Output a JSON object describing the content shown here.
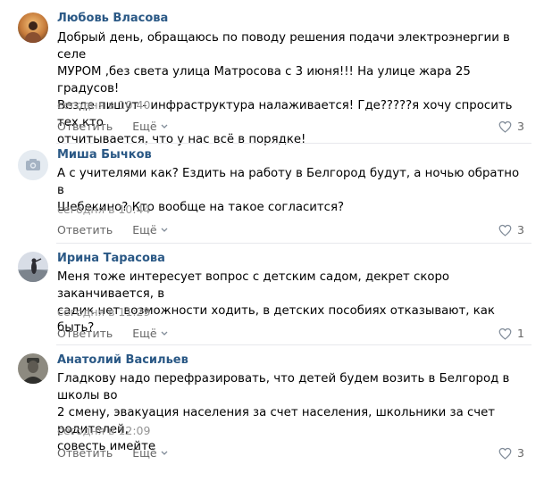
{
  "comments": [
    {
      "author": "Любовь Власова",
      "text": "Добрый день, обращаюсь по поводу решения подачи электроэнергии в селе\nМУРОМ ,без света улица Матросова с 3 июня!!! На улице жара 25 градусов!\nВезде пишут - инфраструктура налаживается! Где?????я хочу спросить тех,кто\nотчитывается, что у нас всё в порядке!",
      "date": "сегодня в 10:40",
      "reply_label": "Ответить",
      "more_label": "Ещё",
      "likes": "3"
    },
    {
      "author": "Миша Бычков",
      "text": "А с учителями как? Ездить на работу в Белгород будут, а ночью обратно в\nШебекино? Кто вообще на такое согласится?",
      "date": "сегодня в 10:44",
      "reply_label": "Ответить",
      "more_label": "Ещё",
      "likes": "3"
    },
    {
      "author": "Ирина Тарасова",
      "text": "Меня тоже интересует вопрос с детским садом, декрет скоро заканчивается, в\nсадик нет возможности ходить, в детских пособиях отказывают, как быть?",
      "date": "сегодня в 11:29",
      "reply_label": "Ответить",
      "more_label": "Ещё",
      "likes": "1"
    },
    {
      "author": "Анатолий Васильев",
      "text": "Гладкову надо перефразировать, что детей будем возить в Белгород в школы во\n2 смену, эвакуация населения за счет населения, школьники за счет родителей,\nсовесть имейте",
      "date": "сегодня в 12:09",
      "reply_label": "Ответить",
      "more_label": "Ещё",
      "likes": "3"
    }
  ],
  "colors": {
    "author": "#2a5885",
    "meta": "#939393",
    "actions": "#656565",
    "divider": "#e7e8ec"
  },
  "icons": [
    "avatar",
    "camera-icon",
    "chevron-down-icon",
    "heart-icon"
  ]
}
